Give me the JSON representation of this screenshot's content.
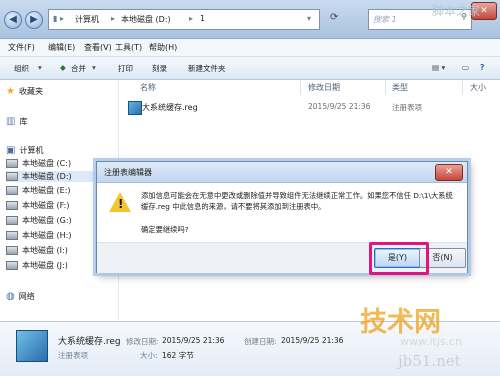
{
  "address": {
    "parts": [
      "计算机",
      "本地磁盘 (D:)",
      "1"
    ],
    "search_placeholder": "搜索 1"
  },
  "menubar": [
    "文件(F)",
    "编辑(E)",
    "查看(V)",
    "工具(T)",
    "帮助(H)"
  ],
  "toolbar": [
    "组织",
    "合并",
    "打印",
    "刻录",
    "新建文件夹"
  ],
  "sidebar": {
    "favorites": "收藏夹",
    "library": "库",
    "computer": "计算机",
    "drives": [
      "本地磁盘 (C:)",
      "本地磁盘 (D:)",
      "本地磁盘 (E:)",
      "本地磁盘 (F:)",
      "本地磁盘 (G:)",
      "本地磁盘 (H:)",
      "本地磁盘 (I:)",
      "本地磁盘 (J:)"
    ],
    "network": "网络"
  },
  "columns": {
    "name": "名称",
    "date": "修改日期",
    "type": "类型",
    "size": "大小"
  },
  "file": {
    "name": "大系统缓存.reg",
    "date": "2015/9/25 21:36",
    "type": "注册表项"
  },
  "dialog": {
    "title": "注册表编辑器",
    "message": "添加信息可能会在无意中更改或删除值并导致组件无法继续正常工作。如果您不信任 D:\\1\\大系统缓存.reg 中此信息的来源，请不要将其添加到注册表中。",
    "confirm": "确定要继续吗?",
    "yes": "是(Y)",
    "no": "否(N)"
  },
  "details": {
    "name": "大系统缓存.reg",
    "modified_label": "修改日期:",
    "modified": "2015/9/25 21:36",
    "created_label": "创建日期:",
    "created": "2015/9/25 21:36",
    "type": "注册表项",
    "size_label": "大小:",
    "size": "162 字节"
  },
  "watermark": {
    "brand": "技术网",
    "url": "www.itjs.cn",
    "corner": "脚本之家",
    "site": "jb51.net"
  }
}
